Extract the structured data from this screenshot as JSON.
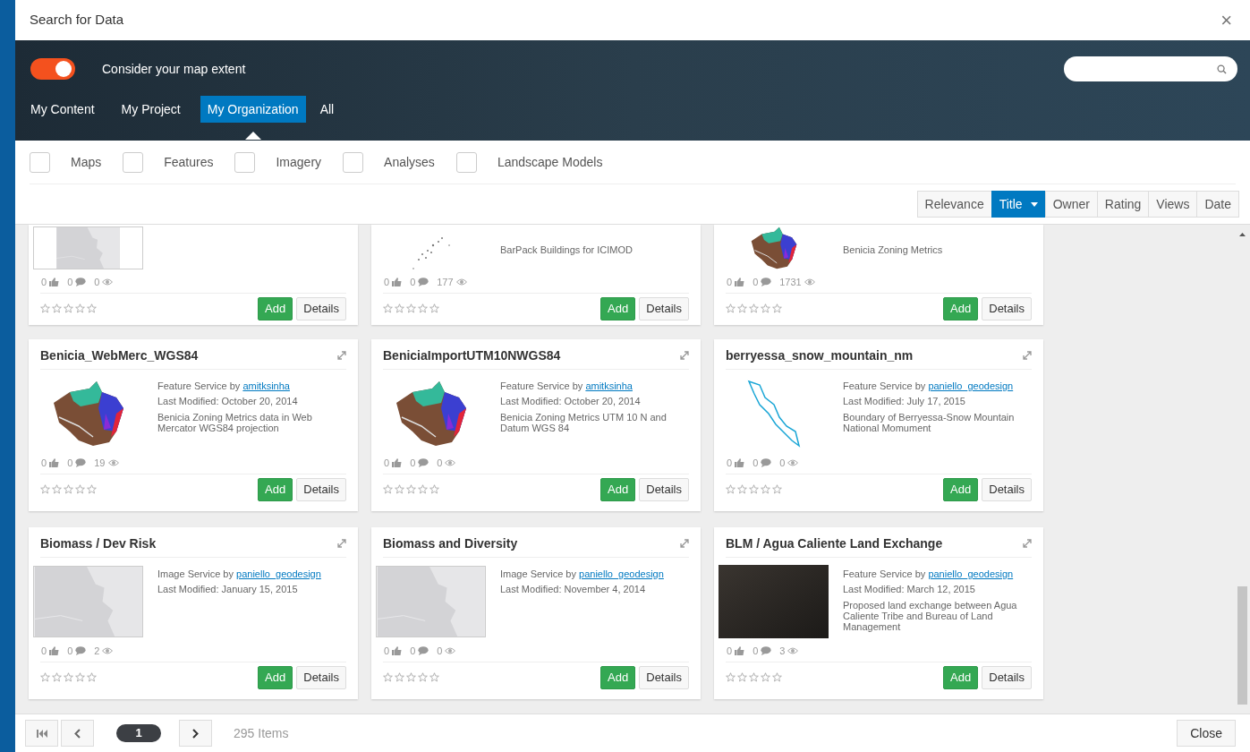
{
  "window": {
    "title": "Search for Data",
    "close_glyph": "×"
  },
  "extent_toggle": {
    "label": "Consider your map extent",
    "on": true
  },
  "tabs": [
    {
      "label": "My Content",
      "selected": false
    },
    {
      "label": "My Project",
      "selected": false
    },
    {
      "label": "My Organization",
      "selected": true
    },
    {
      "label": "All",
      "selected": false
    }
  ],
  "filters": [
    {
      "label": "Maps",
      "checked": false
    },
    {
      "label": "Features",
      "checked": false
    },
    {
      "label": "Imagery",
      "checked": false
    },
    {
      "label": "Analyses",
      "checked": false
    },
    {
      "label": "Landscape Models",
      "checked": false
    }
  ],
  "sort": [
    {
      "label": "Relevance",
      "selected": false
    },
    {
      "label": "Title",
      "selected": true
    },
    {
      "label": "Owner",
      "selected": false
    },
    {
      "label": "Rating",
      "selected": false
    },
    {
      "label": "Views",
      "selected": false
    },
    {
      "label": "Date",
      "selected": false
    }
  ],
  "partial_cards": [
    {
      "kind": "map",
      "likes": "0",
      "comments": "0",
      "views": "0",
      "stars": 0,
      "add": "Add",
      "details": "Details"
    },
    {
      "kind": "points",
      "description": "BarPack Buildings for ICIMOD",
      "likes": "0",
      "comments": "0",
      "views": "177",
      "stars": 0,
      "add": "Add",
      "details": "Details"
    },
    {
      "kind": "zoning",
      "description": "Benicia Zoning Metrics",
      "likes": "0",
      "comments": "0",
      "views": "1731",
      "stars": 0,
      "add": "Add",
      "details": "Details"
    }
  ],
  "cards": [
    {
      "title": "Benicia_WebMerc_WGS84",
      "kind": "zoning",
      "service": "Feature Service by ",
      "owner": "amitksinha",
      "modified": "Last Modified: October 20, 2014",
      "description": "Benicia Zoning Metrics data in Web Mercator WGS84 projection",
      "likes": "0",
      "comments": "0",
      "views": "19",
      "stars": 0,
      "add": "Add",
      "details": "Details"
    },
    {
      "title": "BeniciaImportUTM10NWGS84",
      "kind": "zoning",
      "service": "Feature Service by ",
      "owner": "amitksinha",
      "modified": "Last Modified: October 20, 2014",
      "description": "Benicia Zoning Metrics UTM 10 N and Datum WGS 84",
      "likes": "0",
      "comments": "0",
      "views": "0",
      "stars": 0,
      "add": "Add",
      "details": "Details"
    },
    {
      "title": "berryessa_snow_mountain_nm",
      "kind": "river",
      "service": "Feature Service by ",
      "owner": "paniello_geodesign",
      "modified": "Last Modified: July 17, 2015",
      "description": "Boundary of Berryessa-Snow Mountain National Momument",
      "likes": "0",
      "comments": "0",
      "views": "0",
      "stars": 0,
      "add": "Add",
      "details": "Details"
    },
    {
      "title": "Biomass / Dev Risk",
      "kind": "map",
      "service": "Image Service by ",
      "owner": "paniello_geodesign",
      "modified": "Last Modified: January 15, 2015",
      "likes": "0",
      "comments": "0",
      "views": "2",
      "stars": 0,
      "add": "Add",
      "details": "Details"
    },
    {
      "title": "Biomass and Diversity",
      "kind": "map",
      "service": "Image Service by ",
      "owner": "paniello_geodesign",
      "modified": "Last Modified: November 4, 2014",
      "likes": "0",
      "comments": "0",
      "views": "0",
      "stars": 0,
      "add": "Add",
      "details": "Details"
    },
    {
      "title": "BLM / Agua Caliente Land Exchange",
      "kind": "photo",
      "service": "Feature Service by ",
      "owner": "paniello_geodesign",
      "modified": "Last Modified: March 12, 2015",
      "description": "Proposed land exchange between Agua Caliente Tribe and Bureau of Land Management",
      "likes": "0",
      "comments": "0",
      "views": "3",
      "stars": 0,
      "add": "Add",
      "details": "Details"
    }
  ],
  "pager": {
    "page": "1",
    "count": "295 Items"
  },
  "close_button": "Close"
}
